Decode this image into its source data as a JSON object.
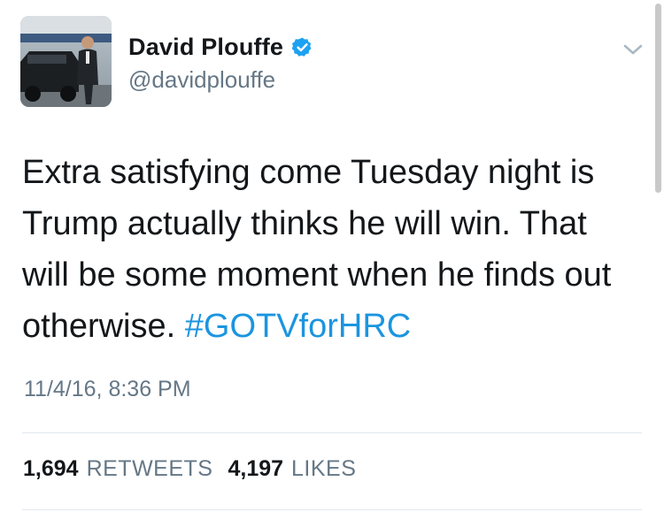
{
  "author": {
    "display_name": "David Plouffe",
    "handle": "@davidplouffe",
    "verified": true,
    "avatar_icon": "profile-photo-avatar"
  },
  "tweet": {
    "lines": [
      "Extra satisfying come Tuesday night is",
      "Trump actually thinks he will win. That",
      "will be some moment when he finds out",
      "otherwise. "
    ],
    "hashtag": "#GOTVforHRC",
    "timestamp": "11/4/16, 8:36 PM"
  },
  "stats": {
    "retweets_count": "1,694",
    "retweets_label": "RETWEETS",
    "likes_count": "4,197",
    "likes_label": "LIKES"
  },
  "colors": {
    "link": "#1b95e0",
    "text": "#14171a",
    "secondary_text": "#657786",
    "verified_badge": "#1da1f2",
    "divider": "#e1e8ed"
  },
  "icons": {
    "verified": "verified-badge-icon",
    "menu": "chevron-down-icon"
  }
}
